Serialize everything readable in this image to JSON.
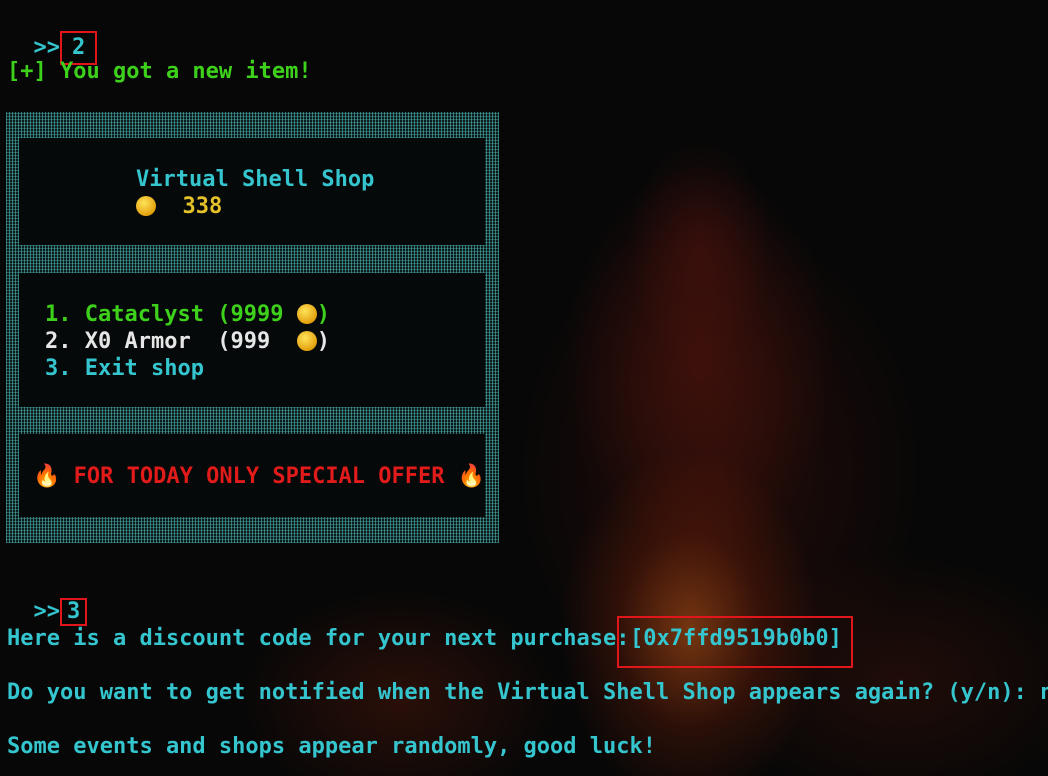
{
  "terminal": {
    "prompt_symbol": ">>",
    "first_input": "2",
    "item_message": "[+] You got a new item!",
    "second_input": "3",
    "discount_label": "Here is a discount code for your next purchase: ",
    "discount_code": "[0x7ffd9519b0b0]",
    "notify_question": "Do you want to get notified when the Virtual Shell Shop appears again? (y/n): n",
    "random_events": "Some events and shops appear randomly, good luck!"
  },
  "shop": {
    "title": "Virtual Shell Shop",
    "coins": "338",
    "items": [
      {
        "number": "1.",
        "name": "Cataclyst",
        "price": "(9999 ",
        "close": ")"
      },
      {
        "number": "2.",
        "name": "X0 Armor ",
        "price": " (999  ",
        "close": ")"
      },
      {
        "number": "3.",
        "name": "Exit shop"
      }
    ],
    "special_offer": "FOR TODAY ONLY SPECIAL OFFER",
    "flame_icon": "fire-icon",
    "coin_icon": "coin-icon"
  },
  "colors": {
    "cyan": "#35c5ce",
    "green": "#3ed11b",
    "yellow": "#e5c229",
    "red": "#e11a1a",
    "highlight_box": "#e0161a"
  }
}
